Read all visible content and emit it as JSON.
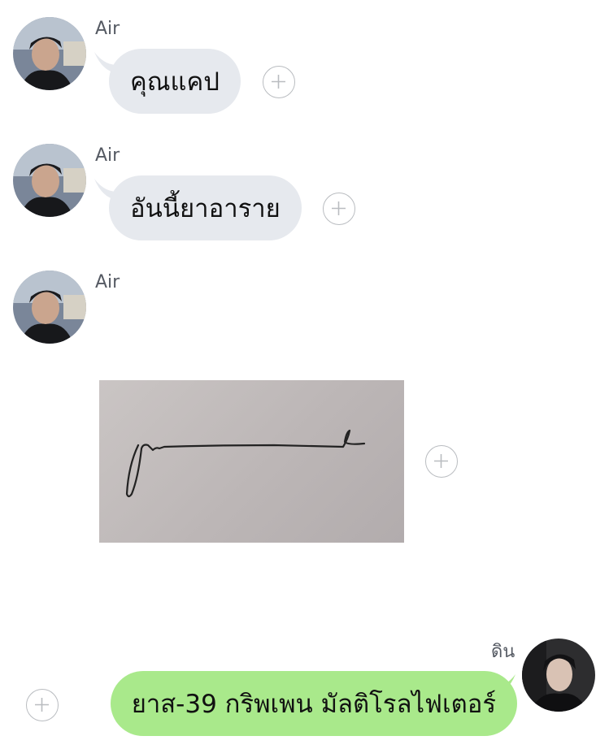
{
  "messages": [
    {
      "sender": "Air",
      "direction": "incoming",
      "type": "text",
      "text": "คุณแคป"
    },
    {
      "sender": "Air",
      "direction": "incoming",
      "type": "text",
      "text": "อันนี้ยาอาราย"
    },
    {
      "sender": "Air",
      "direction": "incoming",
      "type": "image",
      "image": "handwritten-signature-photo"
    },
    {
      "sender": "ดิน",
      "direction": "outgoing",
      "type": "text",
      "text": "ยาส-39 กริพเพน มัลติโรลไฟเตอร์"
    }
  ],
  "icons": {
    "add": "plus-circle-icon",
    "avatar": "user-avatar-photo"
  },
  "colors": {
    "incoming_bubble": "#e6e9ee",
    "outgoing_bubble": "#a9e98b",
    "sender_name": "#555a63",
    "add_icon": "#b9bcc0"
  }
}
